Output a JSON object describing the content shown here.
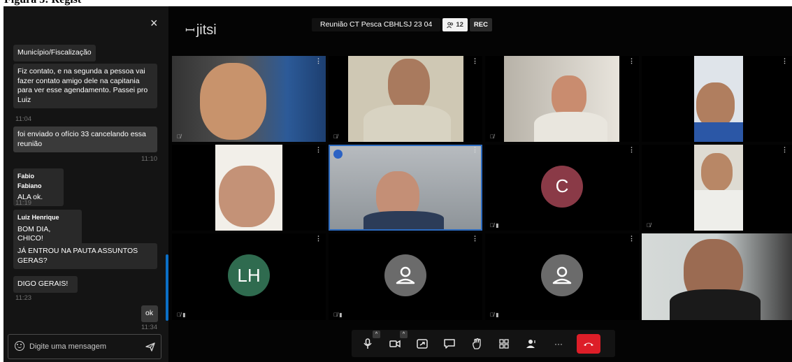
{
  "window": {
    "title": "Reunião CT Pesca CBHLSJ 23 04",
    "participant_count": "12",
    "rec_label": "REC",
    "caption": "Figura 3: Regist"
  },
  "app": {
    "logo_text": "jitsi"
  },
  "colors": {
    "accent": "#0b6fc7",
    "hangup": "#dd1e28",
    "avatar_c": "#8a3a47",
    "avatar_lh": "#2f6b4f"
  },
  "chat": {
    "close_glyph": "×",
    "messages": [
      {
        "sender": "",
        "text": "Município/Fiscalização",
        "time": ""
      },
      {
        "sender": "",
        "text": "Fiz contato, e na segunda a pessoa vai fazer contato amigo dele na capitania para ver esse agendamento.  Passei pro Luiz",
        "time": "11:04"
      },
      {
        "sender": "",
        "text": "foi enviado o ofício 33 cancelando essa reunião",
        "time": "11:10",
        "mine": true
      },
      {
        "sender": "Fabio Fabiano",
        "text": "ALA ok.",
        "time": "11:19"
      },
      {
        "sender": "Luiz Henrique",
        "text": "BOM DIA, CHICO!",
        "time": ""
      },
      {
        "sender": "",
        "text": "JÁ ENTROU NA PAUTA ASSUNTOS GERAS?",
        "time": ""
      },
      {
        "sender": "",
        "text": "DIGO GERAIS!",
        "time": "11:23"
      },
      {
        "sender": "",
        "text": "ok",
        "time": "11:34",
        "mine": true
      }
    ],
    "input_placeholder": "Digite uma mensagem"
  },
  "tiles": [
    {
      "kind": "video",
      "skin": "#c8936c",
      "bg": "#2c5a98"
    },
    {
      "kind": "video",
      "skin": "#a97a5e",
      "bg": "#cfc8b4"
    },
    {
      "kind": "video",
      "skin": "#c98c6f",
      "bg": "#d9d6cf"
    },
    {
      "kind": "video",
      "skin": "#b07e5f",
      "bg": "#dfe4ea"
    },
    {
      "kind": "video",
      "skin": "#c49277",
      "bg": "#f2efe9"
    },
    {
      "kind": "video",
      "skin": "#c48f76",
      "bg": "#a0a4a8"
    },
    {
      "kind": "avatar",
      "initials": "C"
    },
    {
      "kind": "video",
      "skin": "#b88766",
      "bg": "#dedbd2"
    },
    {
      "kind": "avatar",
      "initials": "LH"
    },
    {
      "kind": "placeholder"
    },
    {
      "kind": "placeholder"
    },
    {
      "kind": "video",
      "skin": "#9b6b52",
      "bg": "#d6dad8"
    }
  ],
  "toolbar": {
    "buttons": [
      "microphone",
      "camera",
      "share-screen",
      "chat",
      "raise-hand",
      "tile-view",
      "invite",
      "more",
      "hangup"
    ],
    "more_label": "···"
  }
}
